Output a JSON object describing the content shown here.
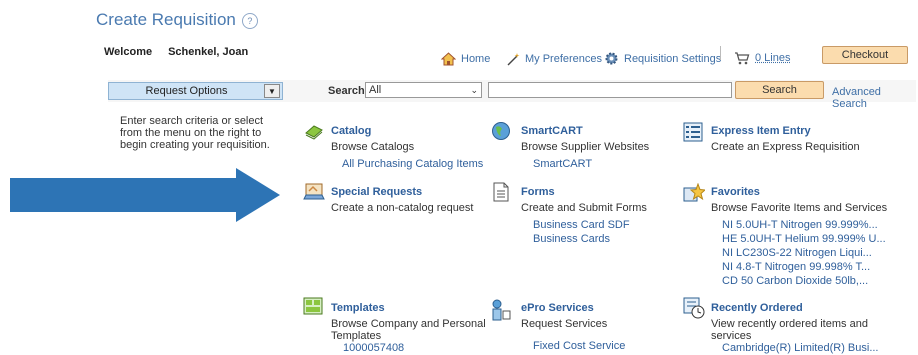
{
  "page": {
    "title": "Create Requisition",
    "help_glyph": "?",
    "welcome_label": "Welcome",
    "user_name": "Schenkel, Joan"
  },
  "nav": {
    "home": "Home",
    "preferences": "My Preferences",
    "settings": "Requisition Settings",
    "lines": "0 Lines",
    "checkout": "Checkout"
  },
  "toolbar": {
    "request_options": "Request Options",
    "search_label": "Search",
    "search_select_value": "All",
    "search_input_value": "",
    "search_button": "Search",
    "advanced_search": "Advanced Search"
  },
  "intro": "Enter search criteria or select from the menu on the right to begin creating your requisition.",
  "tiles": {
    "catalog": {
      "title": "Catalog",
      "desc": "Browse Catalogs",
      "links": [
        "All Purchasing Catalog Items"
      ]
    },
    "smartcart": {
      "title": "SmartCART",
      "desc": "Browse Supplier Websites",
      "links": [
        "SmartCART"
      ]
    },
    "express": {
      "title": "Express Item Entry",
      "desc": "Create an Express Requisition",
      "links": []
    },
    "special": {
      "title": "Special Requests",
      "desc": "Create a non-catalog request",
      "links": []
    },
    "forms": {
      "title": "Forms",
      "desc": "Create and Submit Forms",
      "links": [
        "Business Card SDF",
        "Business Cards"
      ]
    },
    "favorites": {
      "title": "Favorites",
      "desc": "Browse Favorite Items and Services",
      "links": [
        "NI 5.0UH-T Nitrogen 99.999%...",
        "HE 5.0UH-T Helium 99.999% U...",
        "NI LC230S-22 Nitrogen Liqui...",
        "NI 4.8-T Nitrogen 99.998% T...",
        "CD 50 Carbon Dioxide 50lb,..."
      ]
    },
    "templates": {
      "title": "Templates",
      "desc": "Browse Company and Personal Templates",
      "links": [
        "1000057408"
      ]
    },
    "epro": {
      "title": "ePro Services",
      "desc": "Request Services",
      "links": [
        "Fixed Cost Service"
      ]
    },
    "recent": {
      "title": "Recently Ordered",
      "desc": "View recently ordered items and services",
      "links": [
        "Cambridge(R) Limited(R) Busi..."
      ]
    }
  },
  "colors": {
    "accent_blue": "#2d74b5",
    "button_orange": "#fbdcae",
    "link_blue": "#2f5f9b"
  }
}
